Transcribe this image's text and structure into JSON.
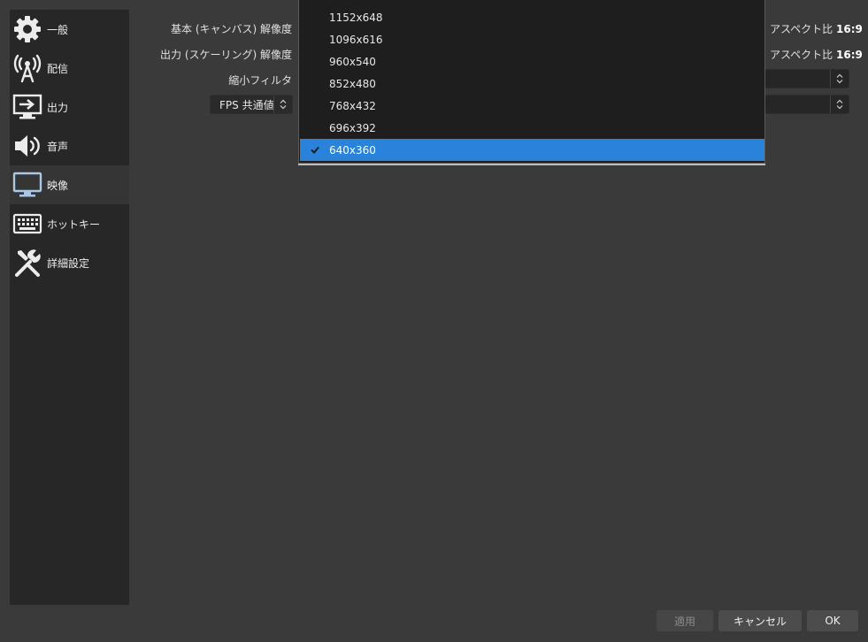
{
  "sidebar": {
    "items": [
      {
        "label": "一般",
        "icon": "gear-icon"
      },
      {
        "label": "配信",
        "icon": "broadcast-icon"
      },
      {
        "label": "出力",
        "icon": "output-icon"
      },
      {
        "label": "音声",
        "icon": "speaker-icon"
      },
      {
        "label": "映像",
        "icon": "monitor-icon"
      },
      {
        "label": "ホットキー",
        "icon": "keyboard-icon"
      },
      {
        "label": "詳細設定",
        "icon": "tools-icon"
      }
    ],
    "active_label": "映像"
  },
  "video": {
    "base_resolution_label": "基本 (キャンバス) 解像度",
    "output_resolution_label": "出力 (スケーリング) 解像度",
    "downscale_filter_label": "縮小フィルタ",
    "fps_type_value": "FPS 共通値",
    "base_aspect": {
      "prefix": "アスペクト比",
      "value": "16:9"
    },
    "output_aspect": {
      "prefix": "アスペクト比",
      "value": "16:9"
    }
  },
  "dropdown": {
    "options": [
      "1152x648",
      "1096x616",
      "960x540",
      "852x480",
      "768x432",
      "696x392",
      "640x360"
    ],
    "selected": "640x360"
  },
  "buttons": {
    "apply": "適用",
    "cancel": "キャンセル",
    "ok": "OK"
  },
  "colors": {
    "accent": "#2a82da",
    "background": "#3a3a3a",
    "sidebar": "#272727"
  }
}
